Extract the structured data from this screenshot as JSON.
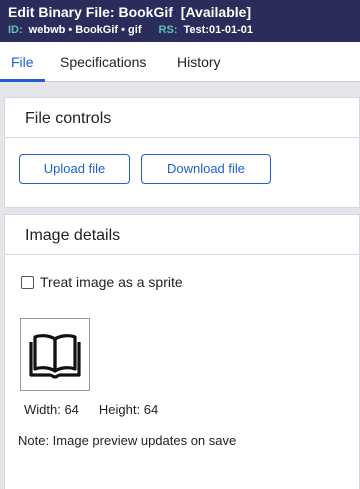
{
  "header": {
    "title": "Edit  Binary File: BookGif",
    "status": "[Available]",
    "id_label": "ID:",
    "id_value": "webwb • BookGif • gif",
    "rs_label": "RS:",
    "rs_value": "Test:01-01-01"
  },
  "tabs": [
    {
      "label": "File",
      "active": true
    },
    {
      "label": "Specifications",
      "active": false
    },
    {
      "label": "History",
      "active": false
    }
  ],
  "file_controls": {
    "heading": "File controls",
    "upload_label": "Upload file",
    "download_label": "Download file"
  },
  "image_details": {
    "heading": "Image details",
    "sprite_label": "Treat image as a sprite",
    "sprite_checked": false,
    "preview_icon": "open-book-icon",
    "width_text": "Width: 64",
    "height_text": "Height: 64",
    "note": "Note: Image preview updates on save"
  },
  "colors": {
    "header_bg": "#2a2d5c",
    "accent": "#1f5fd1",
    "meta_label": "#5ec2b8"
  }
}
